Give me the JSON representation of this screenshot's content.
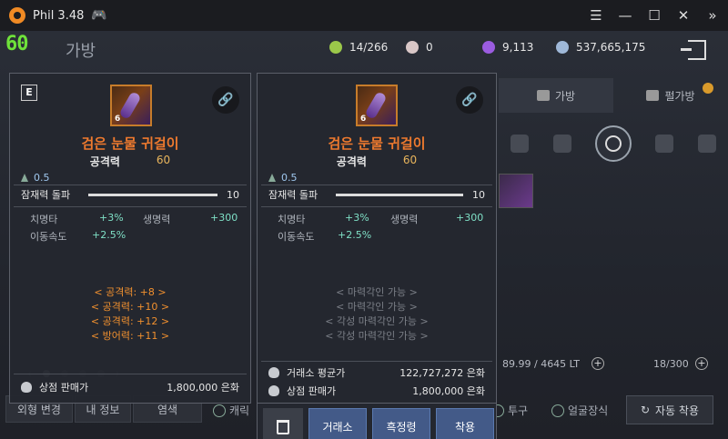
{
  "titlebar": {
    "title": "Phil 3.48",
    "controls": [
      "menu-icon",
      "minimize-icon",
      "maximize-icon",
      "close-icon",
      "collapse-icon"
    ]
  },
  "hud": {
    "fps": "60",
    "bag_title": "가방",
    "currency": [
      {
        "icon": "energy-icon",
        "value": "14/266",
        "color": "#9bc84a"
      },
      {
        "icon": "pearl-icon",
        "value": "0",
        "color": "#d9c7c7"
      },
      {
        "icon": "crystal-icon",
        "value": "9,113",
        "color": "#9b5ce0"
      },
      {
        "icon": "silver-icon",
        "value": "537,665,175",
        "color": "#9fb8d8"
      }
    ]
  },
  "inventory": {
    "tabs": [
      {
        "label": "가방",
        "icon": "bag-icon",
        "active": true
      },
      {
        "label": "펄가방",
        "icon": "pearl-bag-icon",
        "active": false
      }
    ],
    "weight": "89.99 / 4645 LT",
    "slots": "18/300"
  },
  "tooltip_left": {
    "badge": "E",
    "item_level": "6",
    "name": "검은 눈물 귀걸이",
    "attack_label": "공격력",
    "attack_value": "60",
    "weight": "0.5",
    "potential_label": "잠재력 돌파",
    "potential_value": "10",
    "stats": [
      {
        "l1": "치명타",
        "v1": "+3%",
        "l2": "생명력",
        "v2": "+300"
      },
      {
        "l1": "이동속도",
        "v1": "+2.5%",
        "l2": "",
        "v2": ""
      }
    ],
    "extras": [
      "< 공격력: +8 >",
      "< 공격력: +10 >",
      "< 공격력: +12 >",
      "< 방어력: +11 >"
    ],
    "sell_label": "상점 판매가",
    "sell_value": "1,800,000 은화"
  },
  "tooltip_right": {
    "item_level": "6",
    "name": "검은 눈물 귀걸이",
    "attack_label": "공격력",
    "attack_value": "60",
    "weight": "0.5",
    "potential_label": "잠재력 돌파",
    "potential_value": "10",
    "stats": [
      {
        "l1": "치명타",
        "v1": "+3%",
        "l2": "생명력",
        "v2": "+300"
      },
      {
        "l1": "이동속도",
        "v1": "+2.5%",
        "l2": "",
        "v2": ""
      }
    ],
    "extras": [
      "< 마력각인 가능 >",
      "< 마력각인 가능 >",
      "< 각성 마력각인 가능 >",
      "< 각성 마력각인 가능 >"
    ],
    "market_label": "거래소 평균가",
    "market_value": "122,727,272 은화",
    "sell_label": "상점 판매가",
    "sell_value": "1,800,000 은화"
  },
  "actions": {
    "exchange": "거래소",
    "tag": "흑정령",
    "equip": "착용"
  },
  "bottom": {
    "appearance": "외형 변경",
    "my_info": "내 정보",
    "dye": "염색",
    "checks": [
      "캐릭",
      "투구",
      "얼굴장식"
    ],
    "auto_equip": "자동 착용"
  }
}
